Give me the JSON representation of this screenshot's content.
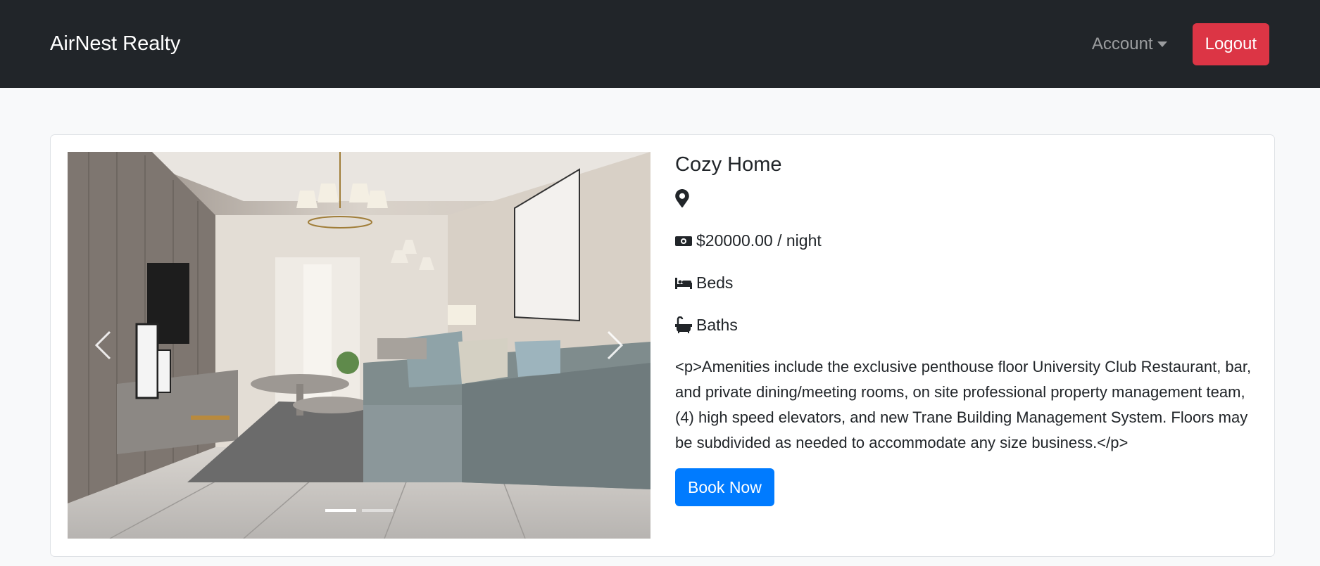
{
  "navbar": {
    "brand": "AirNest Realty",
    "account_label": "Account",
    "logout_label": "Logout",
    "logout_color": "#dc3545"
  },
  "listing": {
    "title": "Cozy Home",
    "location": "",
    "price": "$20000.00 / night",
    "beds": "Beds",
    "baths": "Baths",
    "description": "<p>Amenities include the exclusive penthouse floor University Club Restaurant, bar, and private dining/meeting rooms, on site professional property management team, (4) high speed elevators, and new Trane Building Management System. Floors may be subdivided as needed to accommodate any size business.</p>",
    "book_label": "Book Now",
    "book_color": "#007bff"
  },
  "carousel": {
    "slide_count": 2,
    "active_slide": 1,
    "image_alt": "living-room-photo"
  },
  "icons": {
    "location": "map-marker-icon",
    "price": "money-bill-icon",
    "beds": "bed-icon",
    "baths": "bath-icon"
  }
}
